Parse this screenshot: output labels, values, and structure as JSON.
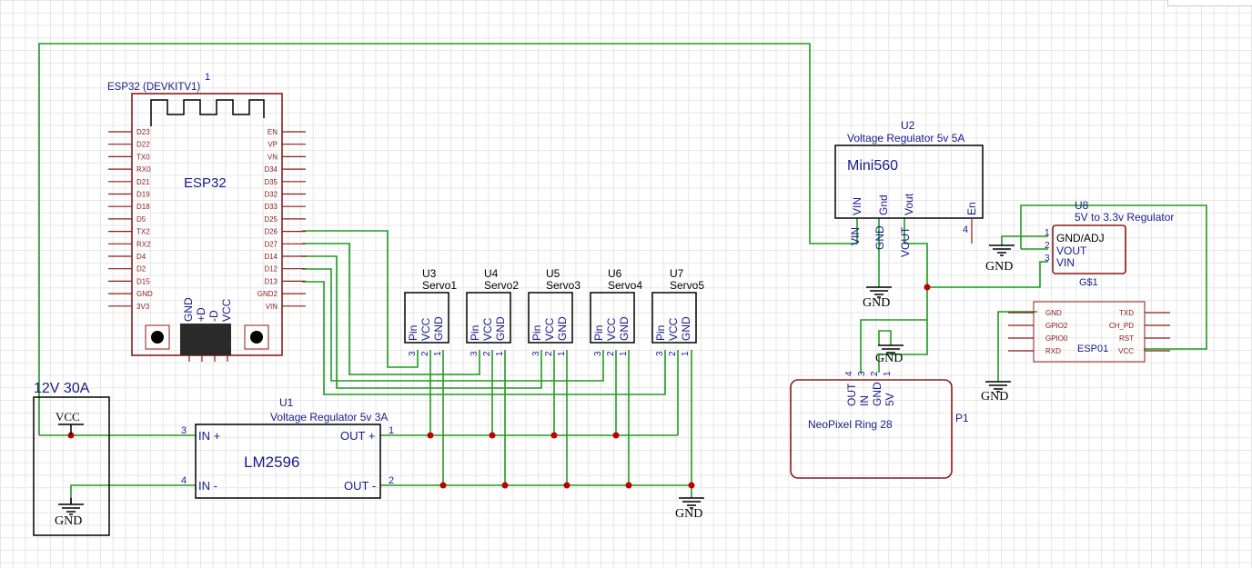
{
  "esp32": {
    "ref": "1",
    "title": "ESP32 (DEVKITV1)",
    "label": "ESP32",
    "left_pins": [
      "D23",
      "D22",
      "TX0",
      "RX0",
      "D21",
      "D19",
      "D18",
      "D5",
      "TX2",
      "RX2",
      "D4",
      "D2",
      "D15",
      "GND",
      "3V3"
    ],
    "right_pins": [
      "EN",
      "VP",
      "VN",
      "D34",
      "D35",
      "D32",
      "D33",
      "D25",
      "D26",
      "D27",
      "D14",
      "D12",
      "D13",
      "GND2",
      "VIN"
    ],
    "bottom_pins": [
      "GND",
      "+D",
      "-D",
      "VCC"
    ]
  },
  "supply": {
    "label": "12V 30A",
    "vcc": "VCC",
    "gnd": "GND"
  },
  "u1": {
    "ref": "U1",
    "title": "Voltage Regulator 5v 3A",
    "name": "LM2596",
    "in_plus": "IN +",
    "in_minus": "IN -",
    "out_plus": "OUT +",
    "out_minus": "OUT -",
    "p1": "1",
    "p2": "2",
    "p3": "3",
    "p4": "4"
  },
  "servos": [
    {
      "ref": "U3",
      "name": "Servo1"
    },
    {
      "ref": "U4",
      "name": "Servo2"
    },
    {
      "ref": "U5",
      "name": "Servo3"
    },
    {
      "ref": "U6",
      "name": "Servo4"
    },
    {
      "ref": "U7",
      "name": "Servo5"
    }
  ],
  "servo_pins": {
    "pin": "Pin",
    "vcc": "VCC",
    "gnd": "GND",
    "n3": "3",
    "n2": "2",
    "n1": "1"
  },
  "u2": {
    "ref": "U2",
    "title": "Voltage Regulator 5v 5A",
    "name": "Mini560",
    "pins_inside": [
      "VIN",
      "Gnd",
      "Vout",
      "En"
    ],
    "pins_outside": [
      "VIN",
      "GND",
      "VOUT"
    ],
    "en_num": "4"
  },
  "u8": {
    "ref": "U8",
    "title": "5V to 3.3v Regulator",
    "gnd_adj": "GND/ADJ",
    "vout": "VOUT",
    "vin": "VIN",
    "n1": "1",
    "n2": "2",
    "n3": "3",
    "part": "G$1"
  },
  "esp01": {
    "name": "ESP01",
    "left": [
      "GND",
      "GPIO2",
      "GPIO0",
      "RXD"
    ],
    "right": [
      "TXD",
      "CH_PD",
      "RST",
      "VCC"
    ]
  },
  "neopixel": {
    "name": "NeoPixel Ring 28",
    "ref": "P1",
    "pins": [
      "OUT",
      "IN",
      "GND",
      "5V"
    ],
    "nums": [
      "4",
      "3",
      "2",
      "1"
    ]
  },
  "gnd_label": "GND"
}
